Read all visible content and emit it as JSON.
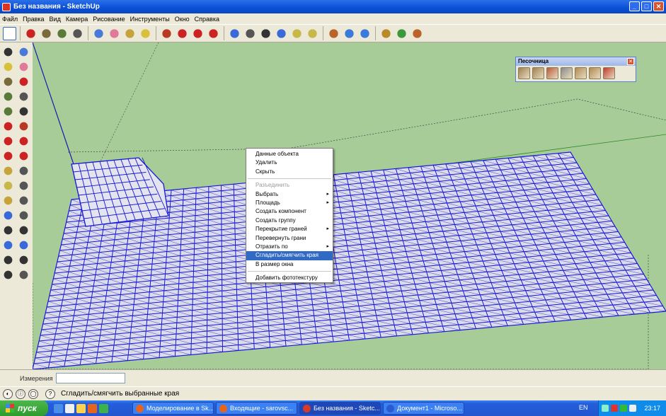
{
  "window": {
    "title": "Без названия - SketchUp",
    "buttons": {
      "minimize": "_",
      "maximize": "□",
      "close": "✕"
    }
  },
  "menu": [
    "Файл",
    "Правка",
    "Вид",
    "Камера",
    "Рисование",
    "Инструменты",
    "Окно",
    "Справка"
  ],
  "toolbar_icons": [
    "select-icon",
    "pencil-icon",
    "rectangle-icon",
    "circle-icon",
    "arc-icon",
    "make-component-icon",
    "eraser-icon",
    "tape-measure-icon",
    "paint-bucket-icon",
    "push-pull-icon",
    "move-icon",
    "rotate-icon",
    "follow-me-icon",
    "orbit-icon",
    "pan-icon",
    "zoom-icon",
    "zoom-extents-icon",
    "previous-view-icon",
    "next-view-icon",
    "position-camera-icon",
    "walk-icon",
    "look-around-icon",
    "get-models-icon",
    "share-model-icon",
    "components-icon"
  ],
  "sandbox": {
    "title": "Песочница",
    "tools": [
      "from-contours-icon",
      "from-scratch-icon",
      "smoove-icon",
      "stamp-icon",
      "drape-icon",
      "add-detail-icon",
      "flip-edge-icon"
    ]
  },
  "context_menu": {
    "items": [
      {
        "label": "Данные объекта",
        "state": "normal",
        "submenu": false
      },
      {
        "label": "Удалить",
        "state": "normal",
        "submenu": false
      },
      {
        "label": "Скрыть",
        "state": "normal",
        "submenu": false
      },
      {
        "sep": true
      },
      {
        "label": "Разъединить",
        "state": "disabled",
        "submenu": false
      },
      {
        "label": "Выбрать",
        "state": "normal",
        "submenu": true
      },
      {
        "label": "Площадь",
        "state": "normal",
        "submenu": true
      },
      {
        "label": "Создать компонент",
        "state": "normal",
        "submenu": false
      },
      {
        "label": "Создать группу",
        "state": "normal",
        "submenu": false
      },
      {
        "label": "Перекрытие граней",
        "state": "normal",
        "submenu": true
      },
      {
        "label": "Перевернуть грани",
        "state": "normal",
        "submenu": false
      },
      {
        "label": "Отразить по",
        "state": "normal",
        "submenu": true
      },
      {
        "label": "Сгладить/смягчить края",
        "state": "highlighted",
        "submenu": false
      },
      {
        "label": "В размер окна",
        "state": "normal",
        "submenu": false
      },
      {
        "sep": true
      },
      {
        "label": "Добавить фототекстуру",
        "state": "normal",
        "submenu": false
      }
    ],
    "submenu_arrow": "▸"
  },
  "measurements": {
    "label": "Измерения",
    "value": ""
  },
  "status": {
    "text": "Сгладить/смягчить выбранные края",
    "help": "?"
  },
  "taskbar": {
    "start": "пуск",
    "tasks": [
      {
        "label": "Моделирование в Sk...",
        "color": "#e8641c"
      },
      {
        "label": "Входящие - sarovsc...",
        "color": "#e8641c"
      },
      {
        "label": "Без названия - Sketc...",
        "color": "#d83a2a",
        "active": true
      },
      {
        "label": "Документ1 - Microso...",
        "color": "#2a5bd0"
      }
    ],
    "lang": "EN",
    "clock": "23:17"
  },
  "colors": {
    "sky": "#a8cc98",
    "mesh": "#1616d8",
    "highlight": "#316ac5"
  }
}
